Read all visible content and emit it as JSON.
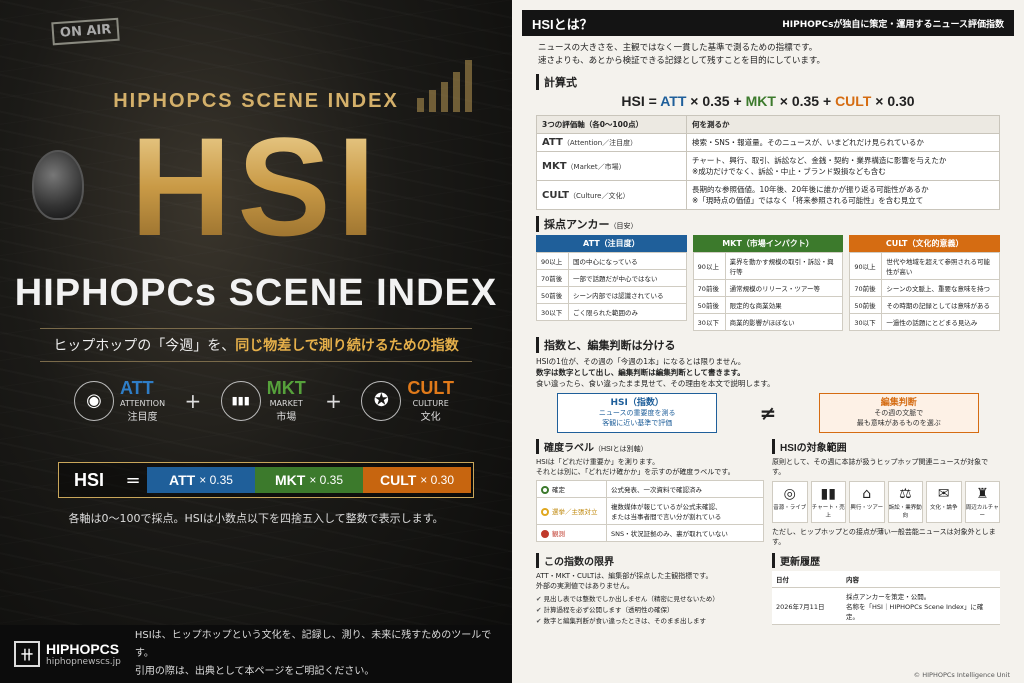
{
  "poster": {
    "onair": "ON AIR",
    "kicker": "HIPHOPCS SCENE INDEX",
    "big": "HSI",
    "subtitle": "HIPHOPCs SCENE INDEX",
    "tagline_a": "ヒップホップの「今週」を、",
    "tagline_b": "同じ物差しで測り続けるための指数",
    "axes": [
      {
        "code": "ATT",
        "en": "ATTENTION",
        "jp": "注目度",
        "color": "#2f7dc6",
        "icon": "eye-icon",
        "glyph": "◉"
      },
      {
        "code": "MKT",
        "en": "MARKET",
        "jp": "市場",
        "color": "#56a13b",
        "icon": "bar-chart-icon",
        "glyph": "▮▮▮"
      },
      {
        "code": "CULT",
        "en": "CULTURE",
        "jp": "文化",
        "color": "#e07a1a",
        "icon": "lightbulb-head-icon",
        "glyph": "✪"
      }
    ],
    "plus": "+",
    "formula": {
      "hsi": "HSI",
      "eq": "=",
      "att": "ATT",
      "mkt": "MKT",
      "cult": "CULT",
      "w_att": "× 0.35",
      "w_mkt": "× 0.35",
      "w_cult": "× 0.30"
    },
    "note": "各軸は0〜100で採点。HSIは小数点以下を四捨五入して整数で表示します。",
    "footer": {
      "logo_mark": "卄",
      "name": "HIPHOPCS",
      "url": "hiphopnewscs.jp",
      "line1": "HSIは、ヒップホップという文化を、記録し、測り、未来に残すためのツールです。",
      "line2": "引用の際は、出典として本ページをご明記ください。"
    }
  },
  "doc": {
    "title": "HSIとは？",
    "strap": "HIPHOPCsが独自に策定・運用するニュース評価指数",
    "intro1": "ニュースの大きさを、主観ではなく一貫した基準で測るための指標です。",
    "intro2": "速さよりも、あとから検証できる記録として残すことを目的にしています。",
    "calc_title": "計算式",
    "formula": {
      "hsi": "HSI",
      "eq": "=",
      "att": "ATT",
      "mkt": "MKT",
      "cult": "CULT",
      "w1": "× 0.35 +",
      "w2": "× 0.35 +",
      "w3": "× 0.30"
    },
    "calc_head": [
      "3つの評価軸（各0〜100点）",
      "何を測るか"
    ],
    "calc_rows": [
      {
        "code": "ATT",
        "jp": "（Attention／注目度）",
        "desc1": "検索・SNS・報道量。そのニュースが、いまどれだけ見られているか",
        "desc2": ""
      },
      {
        "code": "MKT",
        "jp": "（Market／市場）",
        "desc1": "チャート、興行、取引、訴訟など、金銭・契約・業界構造に影響を与えたか",
        "desc2": "※成功だけでなく、訴訟・中止・ブランド毀損なども含む"
      },
      {
        "code": "CULT",
        "jp": "（Culture／文化）",
        "desc1": "長期的な参照価値。10年後、20年後に誰かが振り返る可能性があるか",
        "desc2": "※「現時点の価値」ではなく「将来参照される可能性」を含む見立て"
      }
    ],
    "anchor_title": "採点アンカー",
    "anchor_sub": "（目安）",
    "anchors": [
      {
        "head": "ATT（注目度）",
        "color": "#1f5f9a",
        "rows": [
          [
            "90以上",
            "国の中心になっている"
          ],
          [
            "70前後",
            "一部で話題だが中心ではない"
          ],
          [
            "50前後",
            "シーン内部では認識されている"
          ],
          [
            "30以下",
            "ごく限られた範囲のみ"
          ]
        ]
      },
      {
        "head": "MKT（市場インパクト）",
        "color": "#3c7a2c",
        "rows": [
          [
            "90以上",
            "業界を動かす規模の取引・訴訟・興行等"
          ],
          [
            "70前後",
            "通常規模のリリース・ツアー等"
          ],
          [
            "50前後",
            "限定的な商業効果"
          ],
          [
            "30以下",
            "商業的影響がほぼない"
          ]
        ]
      },
      {
        "head": "CULT（文化的意義）",
        "color": "#d56c12",
        "rows": [
          [
            "90以上",
            "世代や地域を超えて参照される可能性が高い"
          ],
          [
            "70前後",
            "シーンの文脈上、重要な意味を持つ"
          ],
          [
            "50前後",
            "その時期の記録としては意味がある"
          ],
          [
            "30以下",
            "一過性の話題にとどまる見込み"
          ]
        ]
      }
    ],
    "judge_title": "指数と、編集判断は分ける",
    "judge1": "HSIの1位が、その週の「今週の1本」になるとは限りません。",
    "judge2": "数字は数字として出し、編集判断は編集判断として書きます。",
    "judge3": "食い違ったら、食い違ったまま見せて、その理由を本文で説明します。",
    "jb_left_title": "HSI（指数）",
    "jb_left_1": "ニュースの重要度を測る",
    "jb_left_2": "客観に近い基準で評価",
    "neq": "≠",
    "jb_right_title": "編集判断",
    "jb_right_1": "その週の文脈で",
    "jb_right_2": "最も意味があるものを選ぶ",
    "conf_title": "確度ラベル",
    "conf_sub": "（HSIとは別軸）",
    "conf_p1": "HSIは「どれだけ重要か」を測ります。",
    "conf_p2": "それとは別に、「どれだけ確かか」を示すのが確度ラベルです。",
    "conf_rows": [
      {
        "label": "確定",
        "color": "#3c7a2c",
        "desc1": "公式発表、一次資料で確認済み",
        "desc2": ""
      },
      {
        "label": "選挙／主張対立",
        "color": "#e0a820",
        "desc1": "複数媒体が報じているが公式未確認、",
        "desc2": "または当事者間で言い分が割れている"
      },
      {
        "label": "観測",
        "color": "#c0392b",
        "desc1": "SNS・状況証拠のみ、裏が取れていない",
        "desc2": ""
      }
    ],
    "scope_title": "HSIの対象範囲",
    "scope_p": "原則として、その週に本誌が扱うヒップホップ関連ニュースが対象です。",
    "scope_items": [
      {
        "icon": "vinyl-record-icon",
        "glyph": "◎",
        "label": "音源・ライブ"
      },
      {
        "icon": "chart-icon",
        "glyph": "▮▮",
        "label": "チャート・売上"
      },
      {
        "icon": "stadium-icon",
        "glyph": "⌂",
        "label": "興行・ツアー"
      },
      {
        "icon": "gavel-icon",
        "glyph": "⚖",
        "label": "訴訟・業界動向"
      },
      {
        "icon": "speech-bubble-icon",
        "glyph": "✉",
        "label": "文化・論争"
      },
      {
        "icon": "tshirt-icon",
        "glyph": "♜",
        "label": "周辺カルチャー"
      }
    ],
    "scope_note": "ただし、ヒップホップとの接点が薄い一般芸能ニュースは対象外とします。",
    "limit_title": "この指数の限界",
    "limit_p1": "ATT・MKT・CULTは、編集部が採点した主観指標です。",
    "limit_p2": "外部の実測値ではありません。",
    "limit_items": [
      "見出し表では整数でしか出しません（精密に見せないため）",
      "計算過程を必ず公開します（透明性の確保）",
      "数字と編集判断が食い違ったときは、そのまま出します"
    ],
    "hist_title": "更新履歴",
    "hist_head": [
      "日付",
      "内容"
    ],
    "hist_date": "2026年7月11日",
    "hist_c1": "採点アンカーを策定・公開。",
    "hist_c2": "名称を「HSI｜HIPHOPCs Scene Index」に確定。",
    "copyright": "© HIPHOPCs Intelligence Unit"
  }
}
